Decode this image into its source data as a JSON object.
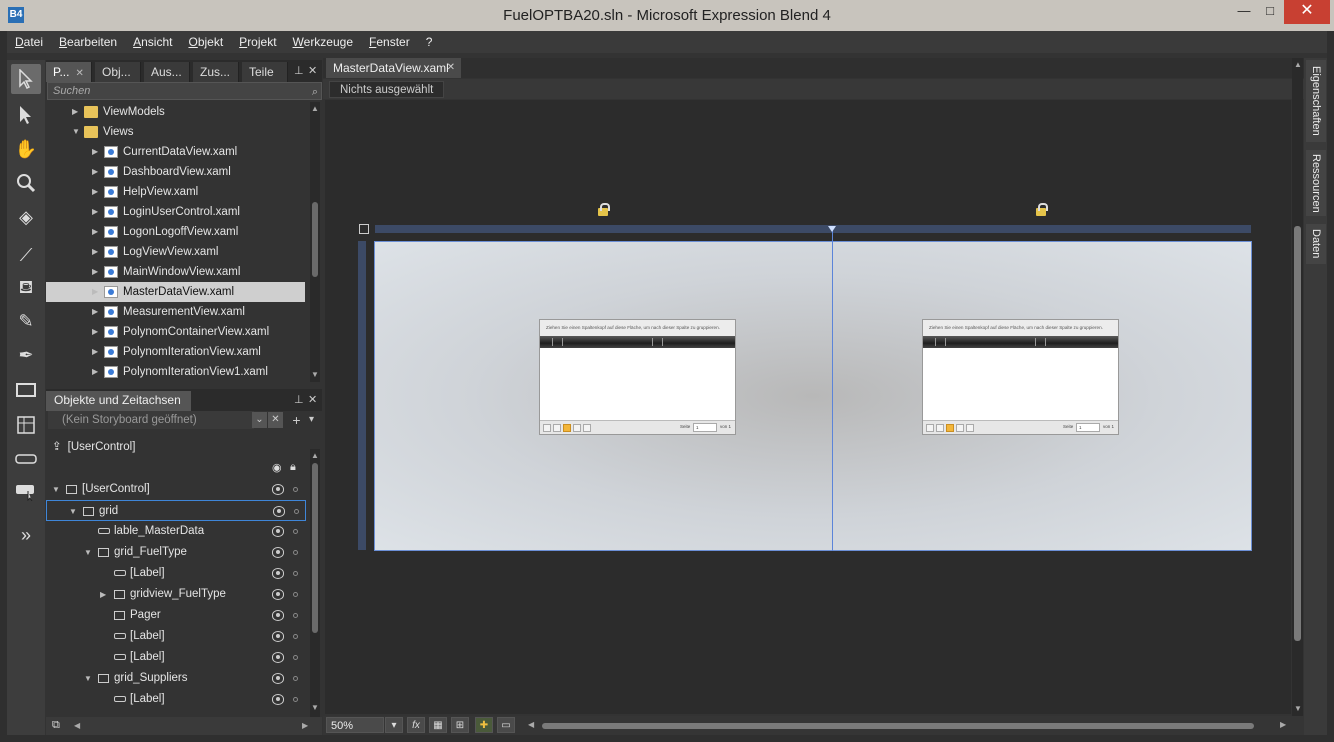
{
  "window": {
    "title": "FuelOPTBA20.sln - Microsoft Expression Blend 4",
    "app_icon": "B4",
    "minimize": "—",
    "maximize": "□",
    "close": "✕"
  },
  "menu": [
    "Datei",
    "Bearbeiten",
    "Ansicht",
    "Objekt",
    "Projekt",
    "Werkzeuge",
    "Fenster",
    "?"
  ],
  "project_panel": {
    "tabs": [
      "P...",
      "Obj...",
      "Aus...",
      "Zus...",
      "Teile"
    ],
    "search_placeholder": "Suchen",
    "tree": [
      {
        "label": "ViewModels",
        "kind": "folder",
        "level": 1,
        "expanded": false
      },
      {
        "label": "Views",
        "kind": "folder",
        "level": 1,
        "expanded": true
      },
      {
        "label": "CurrentDataView.xaml",
        "kind": "xaml",
        "level": 2
      },
      {
        "label": "DashboardView.xaml",
        "kind": "xaml",
        "level": 2
      },
      {
        "label": "HelpView.xaml",
        "kind": "xaml",
        "level": 2
      },
      {
        "label": "LoginUserControl.xaml",
        "kind": "xaml",
        "level": 2
      },
      {
        "label": "LogonLogoffView.xaml",
        "kind": "xaml",
        "level": 2
      },
      {
        "label": "LogViewView.xaml",
        "kind": "xaml",
        "level": 2
      },
      {
        "label": "MainWindowView.xaml",
        "kind": "xaml",
        "level": 2
      },
      {
        "label": "MasterDataView.xaml",
        "kind": "xaml",
        "level": 2,
        "selected": true
      },
      {
        "label": "MeasurementView.xaml",
        "kind": "xaml",
        "level": 2
      },
      {
        "label": "PolynomContainerView.xaml",
        "kind": "xaml",
        "level": 2
      },
      {
        "label": "PolynomIterationView.xaml",
        "kind": "xaml",
        "level": 2
      },
      {
        "label": "PolynomIterationView1.xaml",
        "kind": "xaml",
        "level": 2
      }
    ]
  },
  "objects_panel": {
    "title": "Objekte und Zeitachsen",
    "storyboard": "(Kein Storyboard geöffnet)",
    "scope": "[UserControl]",
    "tree": [
      {
        "label": "[UserControl]",
        "level": 0,
        "icon": "usercontrol-icon",
        "expander": "▼"
      },
      {
        "label": "grid",
        "level": 1,
        "icon": "grid-icon",
        "expander": "▼",
        "selected": true
      },
      {
        "label": "lable_MasterData",
        "level": 2,
        "icon": "label-icon",
        "expander": ""
      },
      {
        "label": "grid_FuelType",
        "level": 2,
        "icon": "grid-icon",
        "expander": "▼"
      },
      {
        "label": "[Label]",
        "level": 3,
        "icon": "label-icon",
        "expander": ""
      },
      {
        "label": "gridview_FuelType",
        "level": 3,
        "icon": "gridview-icon",
        "expander": "▶"
      },
      {
        "label": "Pager",
        "level": 3,
        "icon": "pager-icon",
        "expander": ""
      },
      {
        "label": "[Label]",
        "level": 3,
        "icon": "label-icon",
        "expander": ""
      },
      {
        "label": "[Label]",
        "level": 3,
        "icon": "label-icon",
        "expander": ""
      },
      {
        "label": "grid_Suppliers",
        "level": 2,
        "icon": "grid-icon",
        "expander": "▼"
      },
      {
        "label": "[Label]",
        "level": 3,
        "icon": "label-icon",
        "expander": ""
      }
    ]
  },
  "document": {
    "tab": "MasterDataView.xaml",
    "breadcrumb": "Nichts ausgewählt",
    "gridview_group_text": "Ziehen Sie einen Spaltenkopf auf diese Fläche, um nach dieser Spalte zu gruppieren.",
    "pager": {
      "seite_label": "Seite",
      "page_value": "1",
      "von_label": "von 1",
      "current_page": "1"
    }
  },
  "right_tabs": [
    "Eigenschaften",
    "Ressourcen",
    "Daten"
  ],
  "status": {
    "zoom": "50%",
    "fx_button": "fx"
  },
  "colors": {
    "accent": "#3f86d8",
    "grid_bar": "#3c4a66",
    "selection": "#cfcfcf"
  }
}
